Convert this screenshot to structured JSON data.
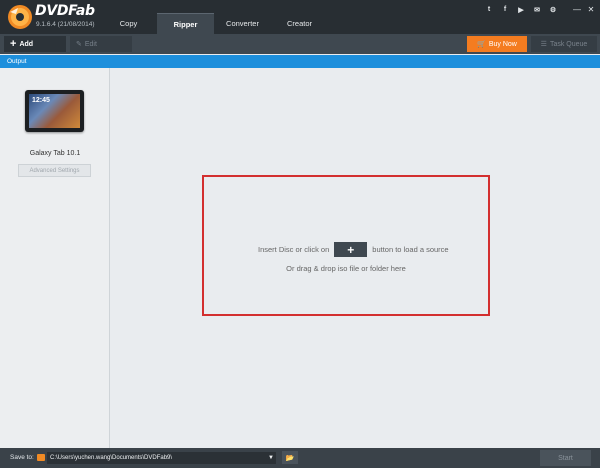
{
  "app": {
    "name": "DVDFab",
    "version": "9.1.6.4 (21/08/2014)"
  },
  "tabs": [
    {
      "label": "Copy",
      "active": false
    },
    {
      "label": "Ripper",
      "active": true
    },
    {
      "label": "Converter",
      "active": false
    },
    {
      "label": "Creator",
      "active": false
    }
  ],
  "social": {
    "twitter": "t",
    "facebook": "f",
    "youtube": "▶",
    "email": "✉",
    "settings": "⚙"
  },
  "window_buttons": {
    "minimize": "—",
    "close": "✕"
  },
  "toolbar": {
    "add_label": "Add",
    "edit_label": "Edit",
    "buy_label": "Buy Now",
    "task_queue_label": "Task Queue"
  },
  "output_label": "Output",
  "profile": {
    "device_name": "Galaxy Tab 10.1",
    "device_clock": "12:45",
    "advanced_settings_label": "Advanced Settings"
  },
  "dropzone": {
    "line1_before": "Insert Disc or click on",
    "line1_after": "button to load a source",
    "line2": "Or drag & drop iso file or folder here"
  },
  "statusbar": {
    "save_to_label": "Save to:",
    "save_path": "C:\\Users\\yuchen.wang\\Documents\\DVDFab9\\",
    "start_label": "Start"
  },
  "colors": {
    "accent_blue": "#1d8fdc",
    "buy_orange": "#f47c20",
    "dropzone_border": "#d32f2f",
    "titlebar": "#282e33"
  }
}
